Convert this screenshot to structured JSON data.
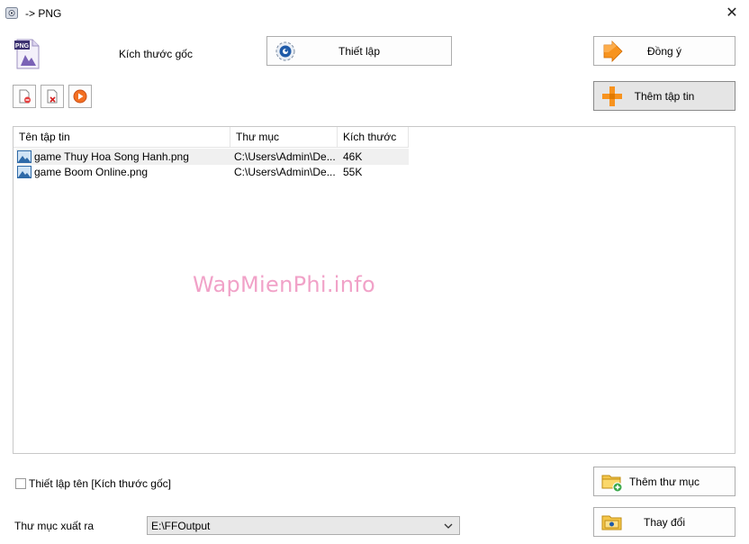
{
  "window": {
    "title": "-> PNG"
  },
  "format": {
    "badge": "PNG",
    "size_label": "Kích thước gốc"
  },
  "buttons": {
    "setup": "Thiết lập",
    "ok": "Đồng ý",
    "add_file": "Thêm tập tin",
    "add_folder": "Thêm thư mục",
    "change": "Thay đổi"
  },
  "file_list": {
    "columns": [
      "Tên tập tin",
      "Thư mục",
      "Kích thước"
    ],
    "rows": [
      {
        "name": "game Thuy Hoa Song Hanh.png",
        "dir": "C:\\Users\\Admin\\De...",
        "size": "46K"
      },
      {
        "name": "game Boom Online.png",
        "dir": "C:\\Users\\Admin\\De...",
        "size": "55K"
      }
    ]
  },
  "watermark": "WapMienPhi.info",
  "options": {
    "rename_checkbox": "Thiết lập tên [Kích thước gốc]",
    "rename_checked": false
  },
  "output": {
    "label": "Thư mục xuất ra",
    "value": "E:\\FFOutput"
  },
  "icons": {
    "app": "app-icon",
    "format": "png-file-icon",
    "setup": "gear-icon",
    "ok": "arrow-right-icon",
    "add_file": "plus-icon",
    "add_folder": "folder-add-icon",
    "change": "folder-open-icon",
    "remove": "remove-file-icon",
    "clear": "clear-list-icon",
    "play": "play-icon",
    "image_file": "image-file-icon",
    "dropdown": "chevron-down-icon",
    "close": "close-icon"
  },
  "colors": {
    "accent_orange": "#f7931e",
    "watermark": "#f1a2c8",
    "badge_purple": "#7a62b6"
  }
}
